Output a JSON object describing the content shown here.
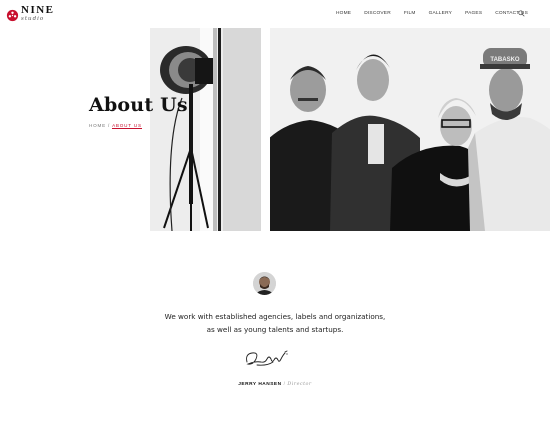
{
  "brand": {
    "name": "NINE",
    "sub": "studio",
    "accent": "#c8102e"
  },
  "nav": {
    "items": [
      "HOME",
      "DISCOVER",
      "FILM",
      "GALLERY",
      "PAGES",
      "CONTACT US"
    ],
    "search_icon": "search-icon"
  },
  "hero": {
    "title": "About Us",
    "breadcrumb": {
      "home": "HOME",
      "separator": "/",
      "current": "ABOUT US"
    },
    "image": "black-and-white photo of studio lamp and four smiling people"
  },
  "content": {
    "quote_line1": "We work with established agencies, labels and organizations,",
    "quote_line2": "as well as young talents and startups.",
    "author_name": "JERRY HANSEN",
    "author_separator": "/",
    "author_role": "Director"
  },
  "colors": {
    "accent": "#c8102e",
    "text": "#222222",
    "muted": "#999999"
  }
}
